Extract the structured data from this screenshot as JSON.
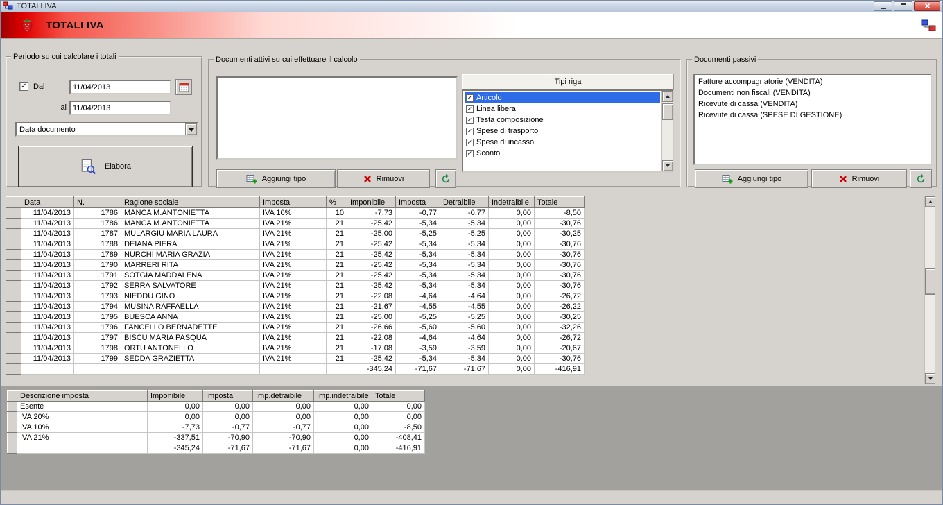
{
  "window": {
    "title": "TOTALI IVA"
  },
  "header": {
    "title": "TOTALI IVA"
  },
  "icons": {
    "checkmark": "✓"
  },
  "colors": {
    "highlight": "#2e6be6",
    "header_red": "#e00000",
    "panel_gray": "#d6d3ce"
  },
  "periodo": {
    "legend": "Periodo su cui calcolare i totali",
    "dal_label": "Dal",
    "dal_checked": true,
    "dal_value": "11/04/2013",
    "al_label": "al",
    "al_value": "11/04/2013",
    "tipo_data_selected": "Data documento",
    "elabora_label": "Elabora"
  },
  "documenti_attivi": {
    "legend": "Documenti attivi su cui effettuare il calcolo",
    "tipi_riga_header": "Tipi riga",
    "tipi": [
      {
        "label": "Articolo",
        "checked": true,
        "selected": true
      },
      {
        "label": "Linea libera",
        "checked": true,
        "selected": false
      },
      {
        "label": "Testa composizione",
        "checked": true,
        "selected": false
      },
      {
        "label": "Spese di trasporto",
        "checked": true,
        "selected": false
      },
      {
        "label": "Spese di incasso",
        "checked": true,
        "selected": false
      },
      {
        "label": "Sconto",
        "checked": true,
        "selected": false
      }
    ],
    "aggiungi_tipo_label": "Aggiungi tipo",
    "rimuovi_label": "Rimuovi"
  },
  "documenti_passivi": {
    "legend": "Documenti passivi",
    "items": [
      "Fatture accompagnatorie (VENDITA)",
      "Documenti non fiscali (VENDITA)",
      "Ricevute di cassa (VENDITA)",
      "Ricevute di cassa (SPESE DI GESTIONE)"
    ],
    "aggiungi_tipo_label": "Aggiungi tipo",
    "rimuovi_label": "Rimuovi"
  },
  "main_table": {
    "headers": [
      "Data",
      "N.",
      "Ragione sociale",
      "Imposta",
      "%",
      "Imponibile",
      "Imposta",
      "Detraibile",
      "Indetraibile",
      "Totale"
    ],
    "rows": [
      [
        "11/04/2013",
        "1786",
        "MANCA M.ANTONIETTA",
        "IVA 10%",
        "10",
        "-7,73",
        "-0,77",
        "-0,77",
        "0,00",
        "-8,50"
      ],
      [
        "11/04/2013",
        "1786",
        "MANCA M.ANTONIETTA",
        "IVA 21%",
        "21",
        "-25,42",
        "-5,34",
        "-5,34",
        "0,00",
        "-30,76"
      ],
      [
        "11/04/2013",
        "1787",
        "MULARGIU MARIA LAURA",
        "IVA 21%",
        "21",
        "-25,00",
        "-5,25",
        "-5,25",
        "0,00",
        "-30,25"
      ],
      [
        "11/04/2013",
        "1788",
        "DEIANA PIERA",
        "IVA 21%",
        "21",
        "-25,42",
        "-5,34",
        "-5,34",
        "0,00",
        "-30,76"
      ],
      [
        "11/04/2013",
        "1789",
        "NURCHI MARIA GRAZIA",
        "IVA 21%",
        "21",
        "-25,42",
        "-5,34",
        "-5,34",
        "0,00",
        "-30,76"
      ],
      [
        "11/04/2013",
        "1790",
        "MARRERI RITA",
        "IVA 21%",
        "21",
        "-25,42",
        "-5,34",
        "-5,34",
        "0,00",
        "-30,76"
      ],
      [
        "11/04/2013",
        "1791",
        "SOTGIA MADDALENA",
        "IVA 21%",
        "21",
        "-25,42",
        "-5,34",
        "-5,34",
        "0,00",
        "-30,76"
      ],
      [
        "11/04/2013",
        "1792",
        "SERRA SALVATORE",
        "IVA 21%",
        "21",
        "-25,42",
        "-5,34",
        "-5,34",
        "0,00",
        "-30,76"
      ],
      [
        "11/04/2013",
        "1793",
        "NIEDDU GINO",
        "IVA 21%",
        "21",
        "-22,08",
        "-4,64",
        "-4,64",
        "0,00",
        "-26,72"
      ],
      [
        "11/04/2013",
        "1794",
        "MUSINA RAFFAELLA",
        "IVA 21%",
        "21",
        "-21,67",
        "-4,55",
        "-4,55",
        "0,00",
        "-26,22"
      ],
      [
        "11/04/2013",
        "1795",
        "BUESCA ANNA",
        "IVA 21%",
        "21",
        "-25,00",
        "-5,25",
        "-5,25",
        "0,00",
        "-30,25"
      ],
      [
        "11/04/2013",
        "1796",
        "FANCELLO BERNADETTE",
        "IVA 21%",
        "21",
        "-26,66",
        "-5,60",
        "-5,60",
        "0,00",
        "-32,26"
      ],
      [
        "11/04/2013",
        "1797",
        "BISCU MARIA PASQUA",
        "IVA 21%",
        "21",
        "-22,08",
        "-4,64",
        "-4,64",
        "0,00",
        "-26,72"
      ],
      [
        "11/04/2013",
        "1798",
        "ORTU ANTONELLO",
        "IVA 21%",
        "21",
        "-17,08",
        "-3,59",
        "-3,59",
        "0,00",
        "-20,67"
      ],
      [
        "11/04/2013",
        "1799",
        "SEDDA GRAZIETTA",
        "IVA 21%",
        "21",
        "-25,42",
        "-5,34",
        "-5,34",
        "0,00",
        "-30,76"
      ]
    ],
    "totals": [
      "-345,24",
      "-71,67",
      "-71,67",
      "0,00",
      "-416,91"
    ]
  },
  "summary_table": {
    "headers": [
      "Descrizione imposta",
      "Imponibile",
      "Imposta",
      "Imp.detraibile",
      "Imp.indetraibile",
      "Totale"
    ],
    "rows": [
      [
        "Esente",
        "0,00",
        "0,00",
        "0,00",
        "0,00",
        "0,00"
      ],
      [
        "IVA 20%",
        "0,00",
        "0,00",
        "0,00",
        "0,00",
        "0,00"
      ],
      [
        "IVA 10%",
        "-7,73",
        "-0,77",
        "-0,77",
        "0,00",
        "-8,50"
      ],
      [
        "IVA 21%",
        "-337,51",
        "-70,90",
        "-70,90",
        "0,00",
        "-408,41"
      ]
    ],
    "totals": [
      "-345,24",
      "-71,67",
      "-71,67",
      "0,00",
      "-416,91"
    ]
  }
}
